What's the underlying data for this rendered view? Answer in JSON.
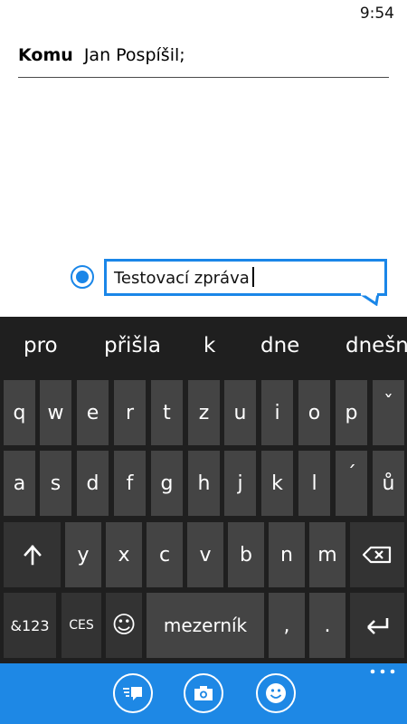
{
  "status": {
    "time": "9:54"
  },
  "recipient": {
    "label": "Komu",
    "name": "Jan Pospíšil;"
  },
  "message": {
    "text": "Testovací zpráva"
  },
  "suggestions": [
    "pro",
    "přišla",
    "k",
    "dne",
    "dnešn"
  ],
  "keyboard": {
    "row1": [
      "q",
      "w",
      "e",
      "r",
      "t",
      "z",
      "u",
      "i",
      "o",
      "p",
      "ˇ"
    ],
    "row2": [
      "a",
      "s",
      "d",
      "f",
      "g",
      "h",
      "j",
      "k",
      "l",
      "´",
      "ů"
    ],
    "row3": [
      "y",
      "x",
      "c",
      "v",
      "b",
      "n",
      "m"
    ],
    "shift": "↑",
    "numbers": "&123",
    "language": "CES",
    "emoji": "☺",
    "space": "mezerník",
    "comma": ",",
    "period": ".",
    "enter": "↵"
  },
  "app_bar": {
    "icons": [
      "send-icon",
      "camera-icon",
      "emoji-icon",
      "more-icon"
    ]
  },
  "colors": {
    "accent": "#1a86e8",
    "app_bar": "#1e88e5",
    "keyboard_bg": "#1f1f1f",
    "key": "#444444"
  }
}
